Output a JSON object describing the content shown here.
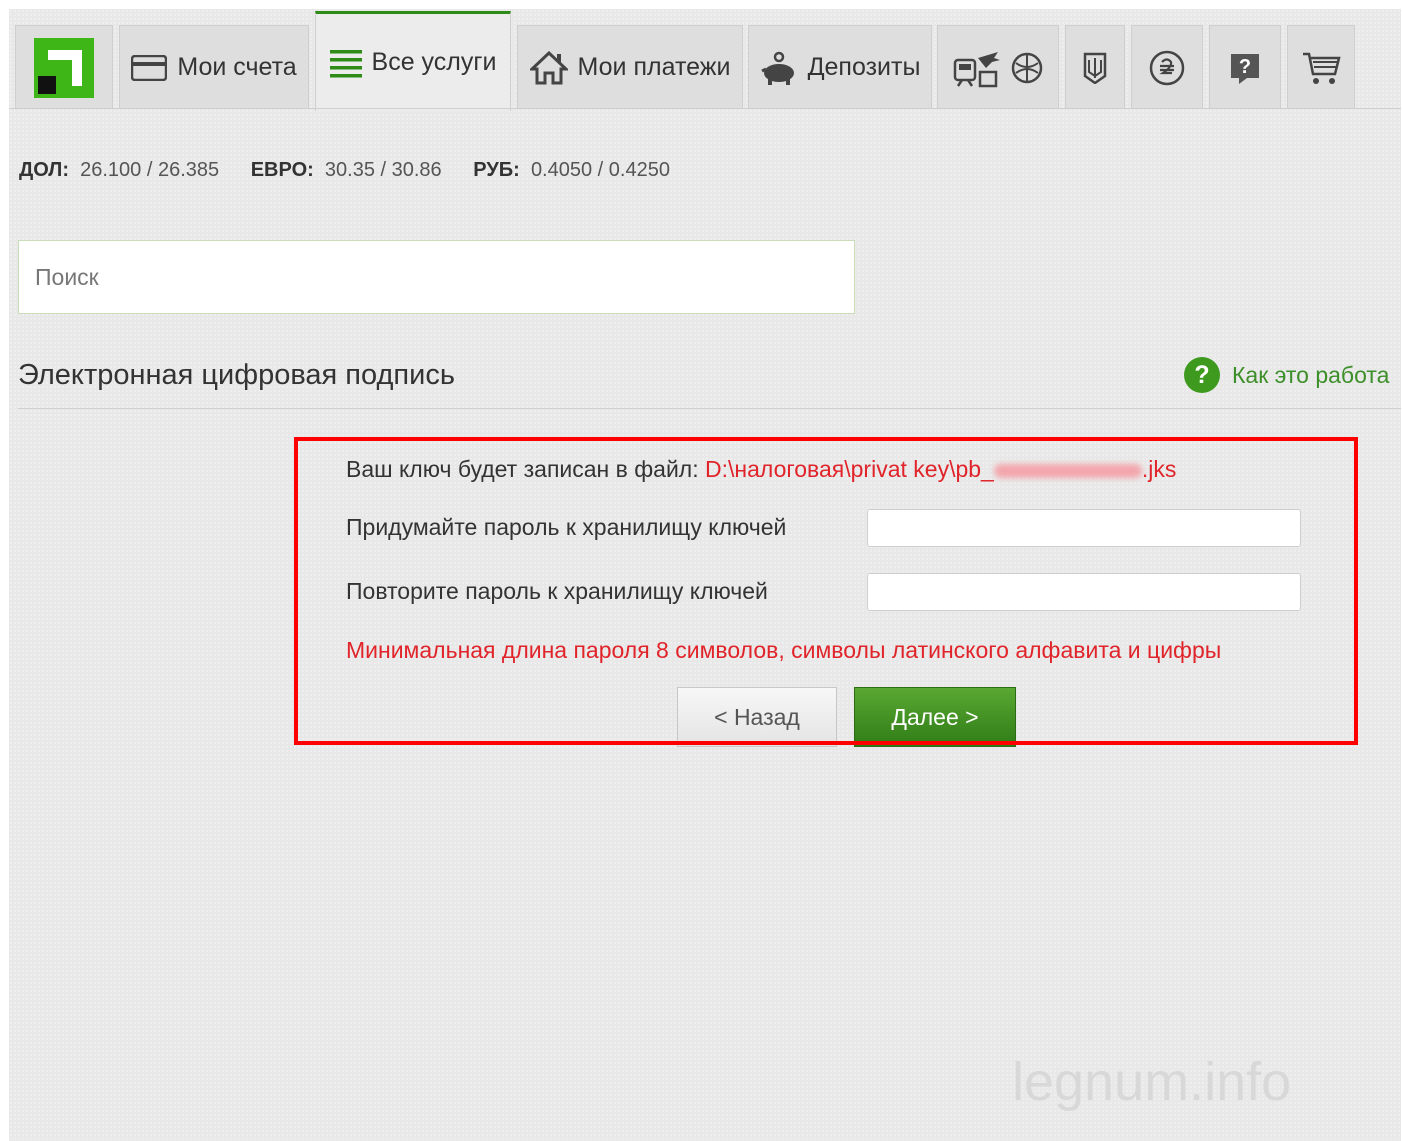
{
  "nav": {
    "tabs": [
      {
        "id": "logo",
        "icon": "privatbank-logo-icon"
      },
      {
        "id": "accounts",
        "label": "Мои счета",
        "icon": "card-icon"
      },
      {
        "id": "services",
        "label": "Все услуги",
        "icon": "menu-lines-icon",
        "active": true
      },
      {
        "id": "payments",
        "label": "Мои платежи",
        "icon": "house-icon"
      },
      {
        "id": "deposits",
        "label": "Депозиты",
        "icon": "piggy-bank-icon"
      },
      {
        "id": "travel",
        "icon": "train-plane-icon"
      },
      {
        "id": "globe",
        "icon": "globe-icon"
      },
      {
        "id": "trident",
        "icon": "trident-icon"
      },
      {
        "id": "hryvnia",
        "icon": "hryvnia-coin-icon"
      },
      {
        "id": "help",
        "icon": "question-icon"
      },
      {
        "id": "cart",
        "icon": "cart-icon"
      }
    ]
  },
  "rates": {
    "usd_label": "ДОЛ:",
    "usd_value": "26.100 / 26.385",
    "eur_label": "ЕВРО:",
    "eur_value": "30.35 / 30.86",
    "rub_label": "РУБ:",
    "rub_value": "0.4050 / 0.4250"
  },
  "search": {
    "placeholder": "Поиск"
  },
  "section": {
    "title": "Электронная цифровая подпись",
    "help_link": "Как это работа"
  },
  "form": {
    "file_label": "Ваш ключ будет записан в файл:",
    "file_path_prefix": "D:\\налоговая\\privat key\\pb_",
    "file_path_suffix": ".jks",
    "password_label": "Придумайте пароль к хранилищу ключей",
    "password_repeat_label": "Повторите пароль к хранилищу ключей",
    "hint": "Минимальная длина пароля 8 символов, символы латинского алфавита и цифры",
    "back_label": "< Назад",
    "next_label": "Далее >"
  },
  "colors": {
    "brand_green": "#3e9a1f",
    "error_red": "#e0242a",
    "highlight": "#ff0000"
  },
  "watermark": "legnum.info"
}
